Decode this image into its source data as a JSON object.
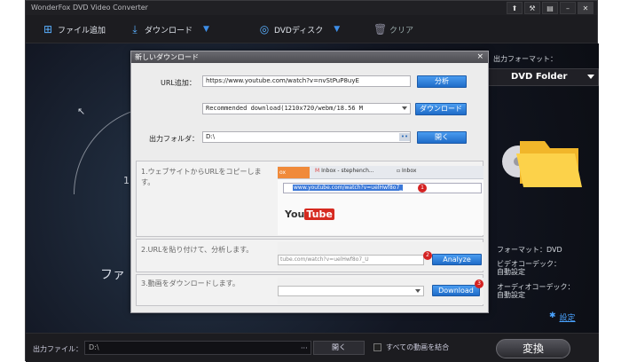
{
  "window": {
    "title": "WonderFox DVD Video Converter"
  },
  "toolbar": {
    "add_file": "ファイル追加",
    "download": "ダウンロード",
    "dvd_disc": "DVDディスク",
    "clear": "クリア"
  },
  "stage": {
    "step_number": "1.",
    "hint_text": "ファ"
  },
  "right_panel": {
    "output_format_label": "出力フォーマット：",
    "format_value": "DVD Folder",
    "format_line": "フォーマット：DVD",
    "video_codec_label": "ビデオコーデック：",
    "video_codec_value": "自動設定",
    "audio_codec_label": "オーディオコーデック：",
    "audio_codec_value": "自動設定",
    "settings": "設定"
  },
  "bottom": {
    "output_file_label": "出力ファイル：",
    "output_path": "D:\\",
    "dots": "···",
    "open": "開く",
    "merge_all": "すべての動画を結合",
    "convert": "変換"
  },
  "dialog": {
    "title": "新しいダウンロード",
    "close": "×",
    "url_label": "URL追加：",
    "url_value": "https://www.youtube.com/watch?v=nvStPuP8uyE",
    "analyze": "分析",
    "quality_value": "Recommended download(1210x720/webm/18.56 M",
    "download": "ダウンロード",
    "folder_label": "出力フォルダ：",
    "folder_value": "D:\\",
    "folder_dots": "••",
    "open": "開く",
    "step1": "1.ウェブサイトからURLをコピーします。",
    "step2": "2.URLを貼り付けて、分析します。",
    "step3": "3.動画をダウンロードします。",
    "shot1": {
      "tab1": "Inbox - stephench...",
      "tab2": "Inbox",
      "tab_small": "ox",
      "address": "www.youtube.com/watch?v=uelHwf8o7_",
      "logo_you": "You",
      "logo_tube": "Tube",
      "badge": "1"
    },
    "shot2": {
      "url": "tube.com/watch?v=uelHwf8o7_U",
      "button": "Analyze",
      "badge": "2"
    },
    "shot3": {
      "button": "Download",
      "badge": "3"
    }
  },
  "colors": {
    "accent": "#3d8ee8",
    "dialog_button": "#2a7ad8",
    "badge": "#d42222"
  }
}
